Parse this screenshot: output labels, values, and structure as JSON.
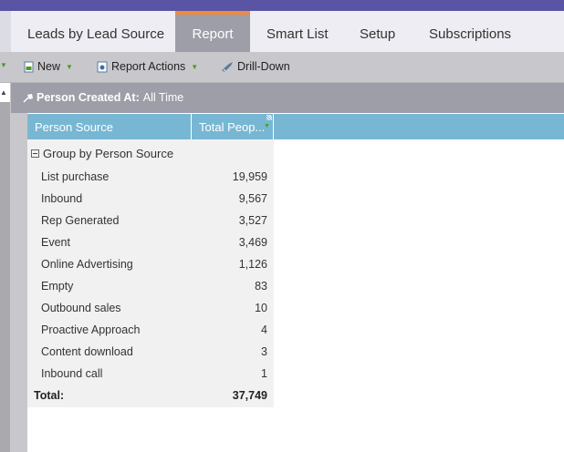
{
  "tabs": [
    {
      "label": "Leads by Lead Source",
      "active": false
    },
    {
      "label": "Report",
      "active": true
    },
    {
      "label": "Smart List",
      "active": false
    },
    {
      "label": "Setup",
      "active": false
    },
    {
      "label": "Subscriptions",
      "active": false
    }
  ],
  "toolbar": {
    "new_label": "New",
    "report_actions_label": "Report Actions",
    "drill_down_label": "Drill-Down"
  },
  "filter": {
    "label": "Person Created At:",
    "value": "All Time"
  },
  "table": {
    "columns": [
      "Person Source",
      "Total Peop..."
    ],
    "group_label": "Group by Person Source",
    "rows": [
      {
        "name": "List purchase",
        "value": "19,959"
      },
      {
        "name": "Inbound",
        "value": "9,567"
      },
      {
        "name": "Rep Generated",
        "value": "3,527"
      },
      {
        "name": "Event",
        "value": "3,469"
      },
      {
        "name": "Online Advertising",
        "value": "1,126"
      },
      {
        "name": "Empty",
        "value": "83"
      },
      {
        "name": "Outbound sales",
        "value": "10"
      },
      {
        "name": "Proactive Approach",
        "value": "4"
      },
      {
        "name": "Content download",
        "value": "3"
      },
      {
        "name": "Inbound call",
        "value": "1"
      }
    ],
    "total_label": "Total:",
    "total_value": "37,749"
  },
  "colors": {
    "brand_bar": "#5a54a4",
    "active_tab": "#9e9ea9",
    "active_tab_accent": "#f08a3c",
    "header_row": "#78b7d3",
    "caret_green": "#4c9a2a"
  }
}
